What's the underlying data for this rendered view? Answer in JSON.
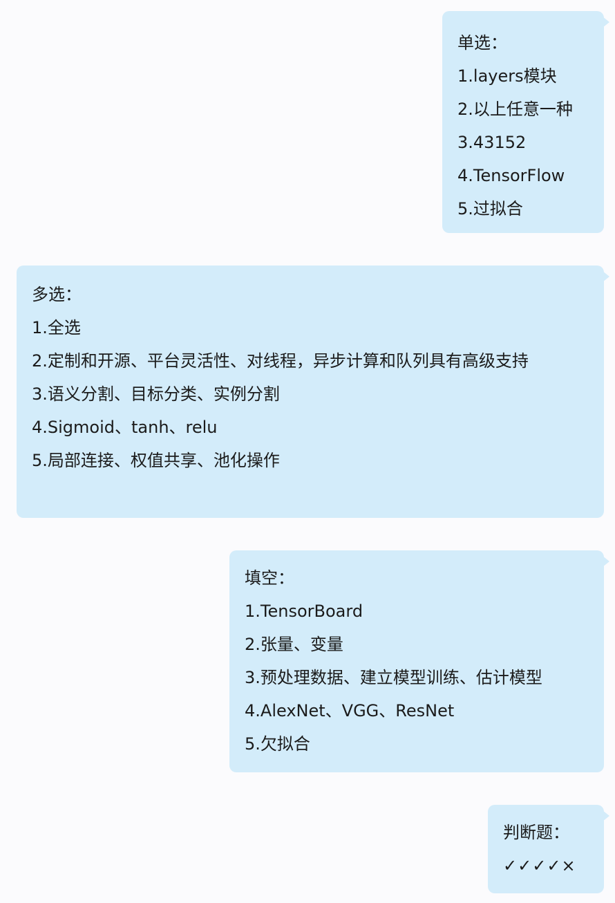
{
  "messages": [
    {
      "title": "单选：",
      "lines": [
        "1.layers模块",
        "2.以上任意一种",
        "3.43152",
        "4.TensorFlow",
        "5.过拟合"
      ]
    },
    {
      "title": "多选：",
      "lines": [
        "1.全选",
        "2.定制和开源、平台灵活性、对线程，异步计算和队列具有高级支持",
        "3.语义分割、目标分类、实例分割",
        "4.Sigmoid、tanh、relu",
        "5.局部连接、权值共享、池化操作"
      ]
    },
    {
      "title": "填空：",
      "lines": [
        "1.TensorBoard",
        "2.张量、变量",
        "3.预处理数据、建立模型训练、估计模型",
        "4.AlexNet、VGG、ResNet",
        "5.欠拟合"
      ]
    },
    {
      "title": "判断题：",
      "lines": [
        "✓✓✓✓×"
      ]
    }
  ],
  "colors": {
    "bubble": "#d3ecfa",
    "background": "#fbfbfd",
    "text": "#1b1b1b"
  }
}
